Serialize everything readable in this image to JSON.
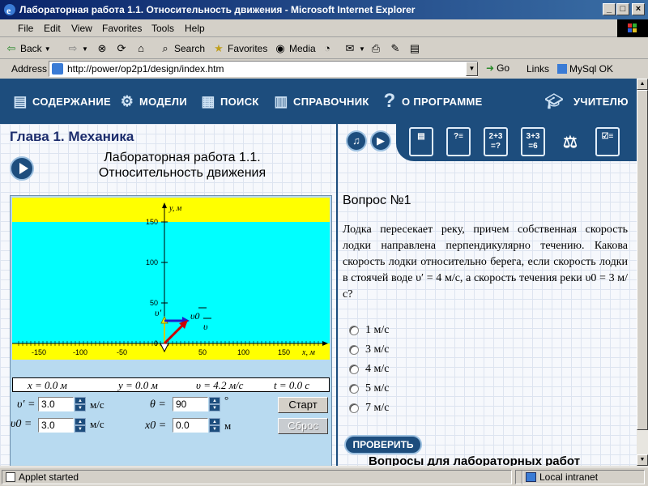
{
  "window": {
    "title": "Лабораторная работа 1.1. Относительность движения - Microsoft Internet Explorer"
  },
  "menu": [
    "File",
    "Edit",
    "View",
    "Favorites",
    "Tools",
    "Help"
  ],
  "toolbar": {
    "back": "Back",
    "search": "Search",
    "favorites": "Favorites",
    "media": "Media"
  },
  "address": {
    "label": "Address",
    "url": "http://power/op2p1/design/index.htm",
    "go": "Go",
    "links": "Links",
    "mysql": "MySql OK"
  },
  "sitenav": {
    "contents": "СОДЕРЖАНИЕ",
    "models": "МОДЕЛИ",
    "search": "ПОИСК",
    "reference": "СПРАВОЧНИК",
    "about": "О ПРОГРАММЕ",
    "teacher": "УЧИТЕЛЮ"
  },
  "lesson": {
    "chapter": "Глава 1. Механика",
    "title_line1": "Лабораторная работа 1.1.",
    "title_line2": "Относительность движения"
  },
  "sim": {
    "y_axis_label": "y, м",
    "x_axis_label": "x, м",
    "y_ticks": [
      "150",
      "100",
      "50",
      "0"
    ],
    "x_ticks": [
      "-150",
      "-100",
      "-50",
      "50",
      "100",
      "150"
    ],
    "vec_prime": "υ′",
    "vec_v0": "υ0",
    "vec_v": "υ",
    "colors": {
      "bank": "#ffff00",
      "water": "#00ffff",
      "vprime": "#ffff00",
      "v0": "#1d1dcc",
      "v": "#cc0000"
    }
  },
  "readout": {
    "x": "x = 0.0 м",
    "y": "y = 0.0 м",
    "v": "υ = 4.2 м/с",
    "t": "t = 0.0 с"
  },
  "controls": {
    "vprime_label": "υ′ =",
    "vprime_value": "3.0",
    "vprime_unit": "м/с",
    "v0_label": "υ0 =",
    "v0_value": "3.0",
    "v0_unit": "м/с",
    "theta_label": "θ =",
    "theta_value": "90",
    "theta_unit": "°",
    "x0_label": "x0 =",
    "x0_value": "0.0",
    "x0_unit": "м",
    "start": "Старт",
    "reset": "Сброс"
  },
  "question": {
    "title": "Вопрос №1",
    "text": "Лодка пересекает реку, причем собственная скорость лодки направлена перпендикулярно течению. Какова скорость лодки относительно берега, если скорость лодки в стоячей воде υ′ = 4 м/с, а скорость течения реки υ0 = 3 м/с?",
    "options": [
      "1 м/с",
      "3 м/с",
      "4 м/с",
      "5 м/с",
      "7 м/с"
    ],
    "check": "ПРОВЕРИТЬ",
    "footer": "Вопросы для лабораторных работ"
  },
  "right_icons": [
    "2+3 =?",
    "3+3 =6"
  ],
  "status": {
    "left": "Applet started",
    "zone": "Local intranet"
  }
}
